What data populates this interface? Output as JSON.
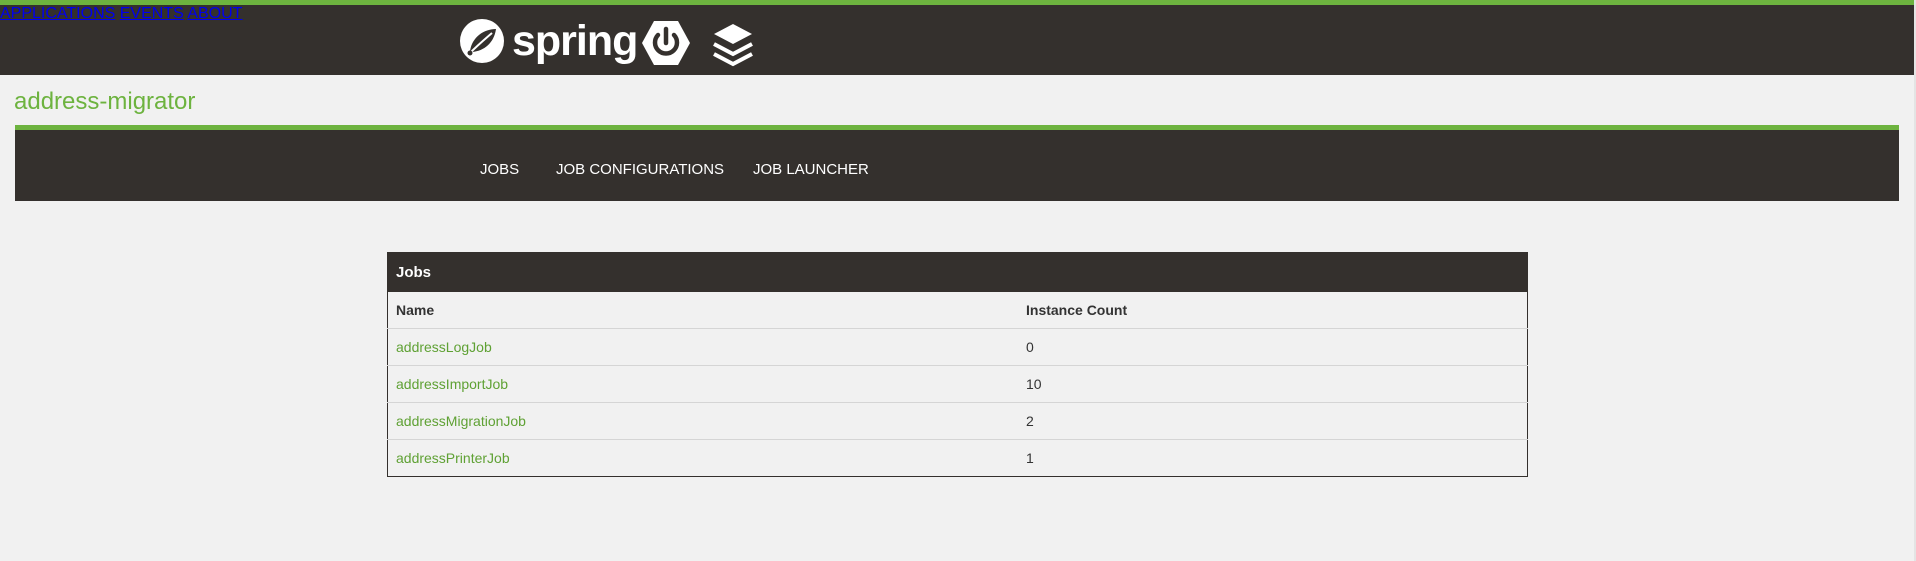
{
  "colors": {
    "brand_green": "#6db33f",
    "dark_bar": "#34302d",
    "link_green": "#5fa134",
    "background": "#f1f1f1"
  },
  "header": {
    "logo_text": "spring",
    "icons": [
      "spring-leaf-icon",
      "spring-boot-power-icon",
      "layers-stack-icon"
    ],
    "nav": {
      "applications": "APPLICATIONS",
      "events": "EVENTS",
      "about": "ABOUT"
    }
  },
  "app": {
    "title": "address-migrator"
  },
  "subnav": {
    "jobs": "JOBS",
    "job_configurations": "JOB CONFIGURATIONS",
    "job_launcher": "JOB LAUNCHER"
  },
  "jobs_table": {
    "panel_title": "Jobs",
    "columns": [
      "Name",
      "Instance Count"
    ],
    "rows": [
      {
        "name": "addressLogJob",
        "instance_count": "0"
      },
      {
        "name": "addressImportJob",
        "instance_count": "10"
      },
      {
        "name": "addressMigrationJob",
        "instance_count": "2"
      },
      {
        "name": "addressPrinterJob",
        "instance_count": "1"
      }
    ]
  }
}
